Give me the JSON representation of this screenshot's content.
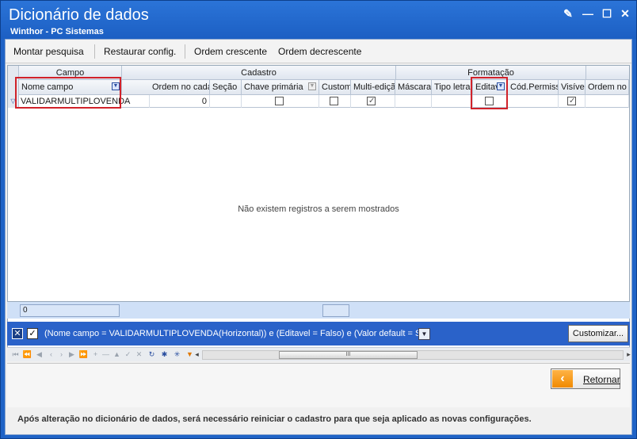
{
  "window": {
    "title": "Dicionário de dados",
    "subtitle": "Winthor - PC Sistemas",
    "buttons": {
      "edit": "✎",
      "minimize": "—",
      "maximize": "☐",
      "close": "✕"
    }
  },
  "menubar": {
    "items": [
      "Montar pesquisa",
      "Restaurar config.",
      "Ordem crescente",
      "Ordem decrescente"
    ]
  },
  "grid": {
    "bands": [
      "Campo",
      "Cadastro",
      "Formatação"
    ],
    "columns": [
      "Nome campo",
      "Ordem no cada",
      "Seção",
      "Chave primária",
      "Custom",
      "Multi-ediçã",
      "Máscara",
      "Tipo letra",
      "Editav",
      "Cód.Permiss",
      "Visível",
      "Ordem no re"
    ],
    "filter_row": {
      "nome_campo": "VALIDARMULTIPLOVENDA",
      "ordem": "0",
      "chave_primaria": false,
      "custom": false,
      "multi_edicao": true,
      "editavel": false,
      "visivel": true
    },
    "empty_message": "Não existem registros a serem mostrados"
  },
  "footer": {
    "count": "0"
  },
  "filterbar": {
    "text": "(Nome campo = VALIDARMULTIPLOVENDA(Horizontal)) e (Editavel = Falso) e (Valor default = S)",
    "customize_label": "Customizar..."
  },
  "navbar": {
    "thumb_label": "III"
  },
  "actions": {
    "return_label": "Retornar"
  },
  "notice": "Após alteração no dicionário de dados, será necessário reiniciar o cadastro para que seja aplicado as novas configurações.",
  "colors": {
    "title_blue": "#1f63c6",
    "filter_blue": "#2a62c9",
    "highlight_red": "#d1222a",
    "return_orange": "#f08a00"
  }
}
